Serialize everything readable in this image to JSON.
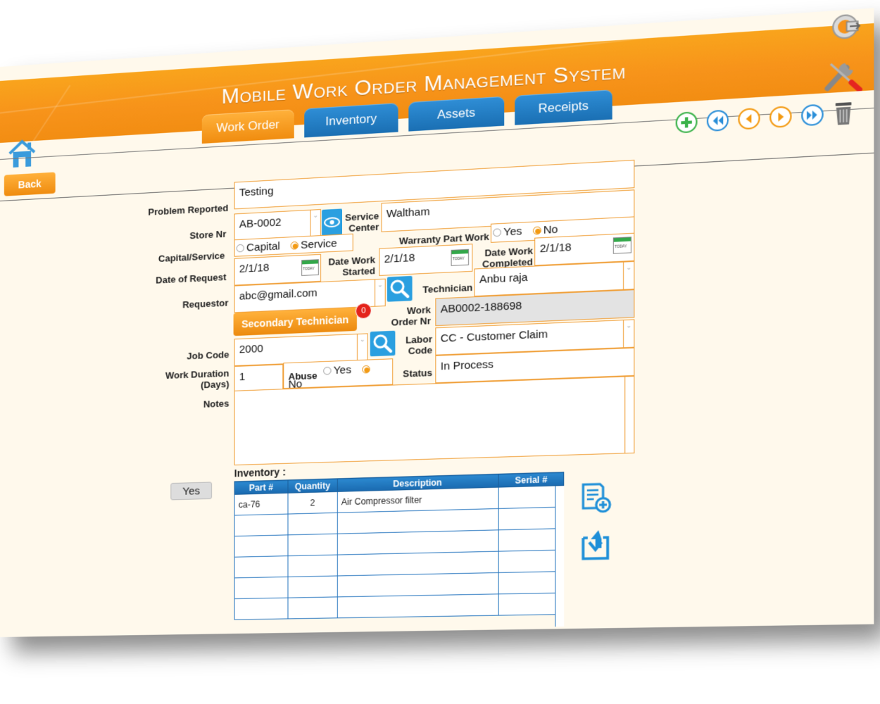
{
  "app": {
    "title": "Mobile Work Order Management System"
  },
  "tabs": [
    {
      "label": "Work Order",
      "active": true
    },
    {
      "label": "Inventory",
      "active": false
    },
    {
      "label": "Assets",
      "active": false
    },
    {
      "label": "Receipts",
      "active": false
    }
  ],
  "toolbar": {
    "back_label": "Back",
    "icons": [
      "add-icon",
      "first-record-icon",
      "previous-record-icon",
      "next-record-icon",
      "last-record-icon",
      "trash-icon"
    ]
  },
  "form": {
    "problem_reported": {
      "label": "Problem Reported",
      "value": "Testing"
    },
    "store_nr": {
      "label": "Store Nr",
      "value": "AB-0002"
    },
    "service_center": {
      "label_1": "Service",
      "label_2": "Center",
      "value": "Waltham"
    },
    "capital_service": {
      "label": "Capital/Service",
      "options": [
        "Capital",
        "Service"
      ],
      "selected": "Service"
    },
    "warranty_part_work": {
      "label": "Warranty Part Work",
      "options": [
        "Yes",
        "No"
      ],
      "selected": "No"
    },
    "date_of_request": {
      "label": "Date of Request",
      "value": "2/1/18"
    },
    "date_work_started": {
      "label_1": "Date Work",
      "label_2": "Started",
      "value": "2/1/18"
    },
    "date_work_completed": {
      "label_1": "Date Work",
      "label_2": "Completed",
      "value": "2/1/18"
    },
    "today_label": "TODAY",
    "requestor": {
      "label": "Requestor",
      "value": "abc@gmail.com"
    },
    "technician": {
      "label": "Technician",
      "value": "Anbu raja"
    },
    "secondary_technician": {
      "label": "Secondary Technician",
      "count": "0"
    },
    "work_order_nr": {
      "label_1": "Work",
      "label_2": "Order Nr",
      "value": "AB0002-188698"
    },
    "job_code": {
      "label": "Job Code",
      "value": "2000"
    },
    "labor_code": {
      "label_1": "Labor",
      "label_2": "Code",
      "value": "CC - Customer Claim"
    },
    "work_duration": {
      "label_1": "Work Duration",
      "label_2": "(Days)",
      "value": "1"
    },
    "abuse": {
      "label": "Abuse",
      "options": [
        "Yes",
        "No"
      ],
      "selected": "No"
    },
    "status": {
      "label": "Status",
      "value": "In Process"
    },
    "notes": {
      "label": "Notes",
      "value": ""
    },
    "yes_button": "Yes"
  },
  "inventory": {
    "title": "Inventory :",
    "columns": [
      "Part #",
      "Quantity",
      "Description",
      "Serial #"
    ],
    "rows": [
      {
        "part": "ca-76",
        "quantity": "2",
        "description": "Air Compressor filter",
        "serial": ""
      }
    ]
  },
  "colors": {
    "accent_orange": "#f7931a",
    "tab_blue": "#1a6fb3",
    "background": "#fff9ec"
  }
}
